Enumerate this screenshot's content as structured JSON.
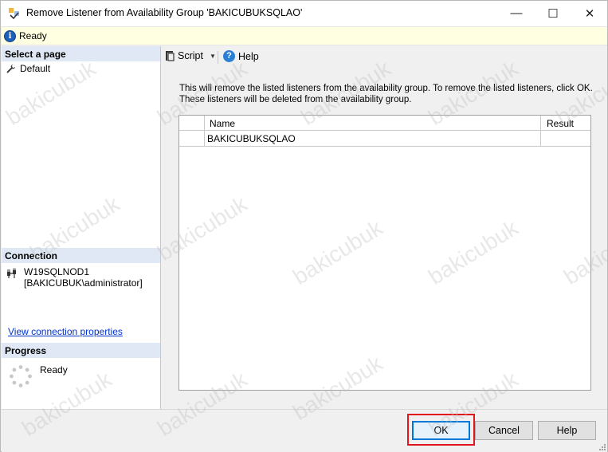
{
  "window": {
    "title": "Remove Listener from Availability Group 'BAKICUBUKSQLAO'",
    "controls": {
      "minimize": "—",
      "maximize": "☐",
      "close": "✕"
    }
  },
  "status": {
    "icon": "info-icon",
    "text": "Ready"
  },
  "sidebar": {
    "select_page_header": "Select a page",
    "pages": [
      {
        "label": "Default",
        "icon": "wrench-icon"
      }
    ],
    "connection_header": "Connection",
    "connection_server": "W19SQLNOD1",
    "connection_user": "[BAKICUBUK\\administrator]",
    "connection_link": "View connection properties",
    "progress_header": "Progress",
    "progress_status": "Ready"
  },
  "toolbar": {
    "script_label": "Script",
    "help_label": "Help"
  },
  "main": {
    "message": "This will remove the listed listeners from the availability group. To remove the listed listeners, click OK. These listeners will be deleted from the availability group.",
    "grid": {
      "columns": [
        "Name",
        "Result"
      ],
      "rows": [
        {
          "name": "BAKICUBUKSQLAO",
          "result": ""
        }
      ]
    }
  },
  "buttons": {
    "ok": "OK",
    "cancel": "Cancel",
    "help": "Help"
  },
  "watermark": "bakicubuk",
  "colors": {
    "highlight": "#e0161c",
    "status_bg": "#ffffe1",
    "section_header_bg": "#dfe8f4",
    "link": "#0033cc"
  }
}
